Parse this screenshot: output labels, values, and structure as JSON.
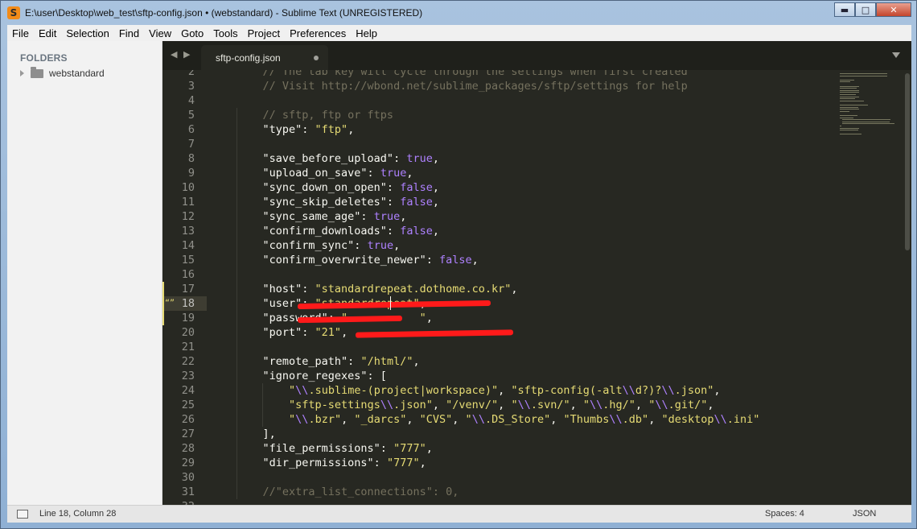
{
  "window": {
    "title": "E:\\user\\Desktop\\web_test\\sftp-config.json • (webstandard) - Sublime Text (UNREGISTERED)",
    "app_icon_glyph": "S",
    "controls": {
      "minimize": "▬",
      "maximize": "□",
      "close": "✕"
    }
  },
  "menu": {
    "items": [
      "File",
      "Edit",
      "Selection",
      "Find",
      "View",
      "Goto",
      "Tools",
      "Project",
      "Preferences",
      "Help"
    ]
  },
  "sidebar": {
    "header": "FOLDERS",
    "folders": [
      {
        "name": "webstandard"
      }
    ]
  },
  "tabs": {
    "nav": "◀ ▶",
    "active": {
      "label": "sftp-config.json",
      "dirty": true
    }
  },
  "editor": {
    "theme": {
      "bg": "#272822",
      "comment": "#75715e",
      "string": "#e6db74",
      "constant": "#ae81ff"
    },
    "lines": [
      {
        "n": "2",
        "text": "    // The tab key will cycle through the settings when first created"
      },
      {
        "n": "3",
        "text": "    // Visit http://wbond.net/sublime_packages/sftp/settings for help"
      },
      {
        "n": "4",
        "text": ""
      },
      {
        "n": "5",
        "text": "    // sftp, ftp or ftps"
      },
      {
        "n": "6",
        "text": "    \"type\": \"ftp\","
      },
      {
        "n": "7",
        "text": ""
      },
      {
        "n": "8",
        "text": "    \"save_before_upload\": true,"
      },
      {
        "n": "9",
        "text": "    \"upload_on_save\": true,"
      },
      {
        "n": "10",
        "text": "    \"sync_down_on_open\": false,"
      },
      {
        "n": "11",
        "text": "    \"sync_skip_deletes\": false,"
      },
      {
        "n": "12",
        "text": "    \"sync_same_age\": true,"
      },
      {
        "n": "13",
        "text": "    \"confirm_downloads\": false,"
      },
      {
        "n": "14",
        "text": "    \"confirm_sync\": true,"
      },
      {
        "n": "15",
        "text": "    \"confirm_overwrite_newer\": false,"
      },
      {
        "n": "16",
        "text": ""
      },
      {
        "n": "17",
        "text": "    \"host\": \"standardrepeat.dothome.co.kr\","
      },
      {
        "n": "18",
        "text": "    \"user\": \"standardrepeat\","
      },
      {
        "n": "19",
        "text": "    \"password\": \"           \","
      },
      {
        "n": "20",
        "text": "    \"port\": \"21\","
      },
      {
        "n": "21",
        "text": ""
      },
      {
        "n": "22",
        "text": "    \"remote_path\": \"/html/\","
      },
      {
        "n": "23",
        "text": "    \"ignore_regexes\": ["
      },
      {
        "n": "24",
        "text": "        \"\\\\.sublime-(project|workspace)\", \"sftp-config(-alt\\\\d?)?\\\\.json\","
      },
      {
        "n": "25",
        "text": "        \"sftp-settings\\\\.json\", \"/venv/\", \"\\\\.svn/\", \"\\\\.hg/\", \"\\\\.git/\","
      },
      {
        "n": "26",
        "text": "        \"\\\\.bzr\", \"_darcs\", \"CVS\", \"\\\\.DS_Store\", \"Thumbs\\\\.db\", \"desktop\\\\.ini\""
      },
      {
        "n": "27",
        "text": "    ],"
      },
      {
        "n": "28",
        "text": "    \"file_permissions\": \"777\","
      },
      {
        "n": "29",
        "text": "    \"dir_permissions\": \"777\","
      },
      {
        "n": "30",
        "text": ""
      },
      {
        "n": "31",
        "text": "    //\"extra_list_connections\": 0,"
      },
      {
        "n": "32",
        "text": ""
      }
    ],
    "current_line": "18",
    "modified_lines": [
      "17",
      "18",
      "19"
    ]
  },
  "status": {
    "position": "Line 18, Column 28",
    "indentation": "Spaces: 4",
    "syntax": "JSON"
  }
}
